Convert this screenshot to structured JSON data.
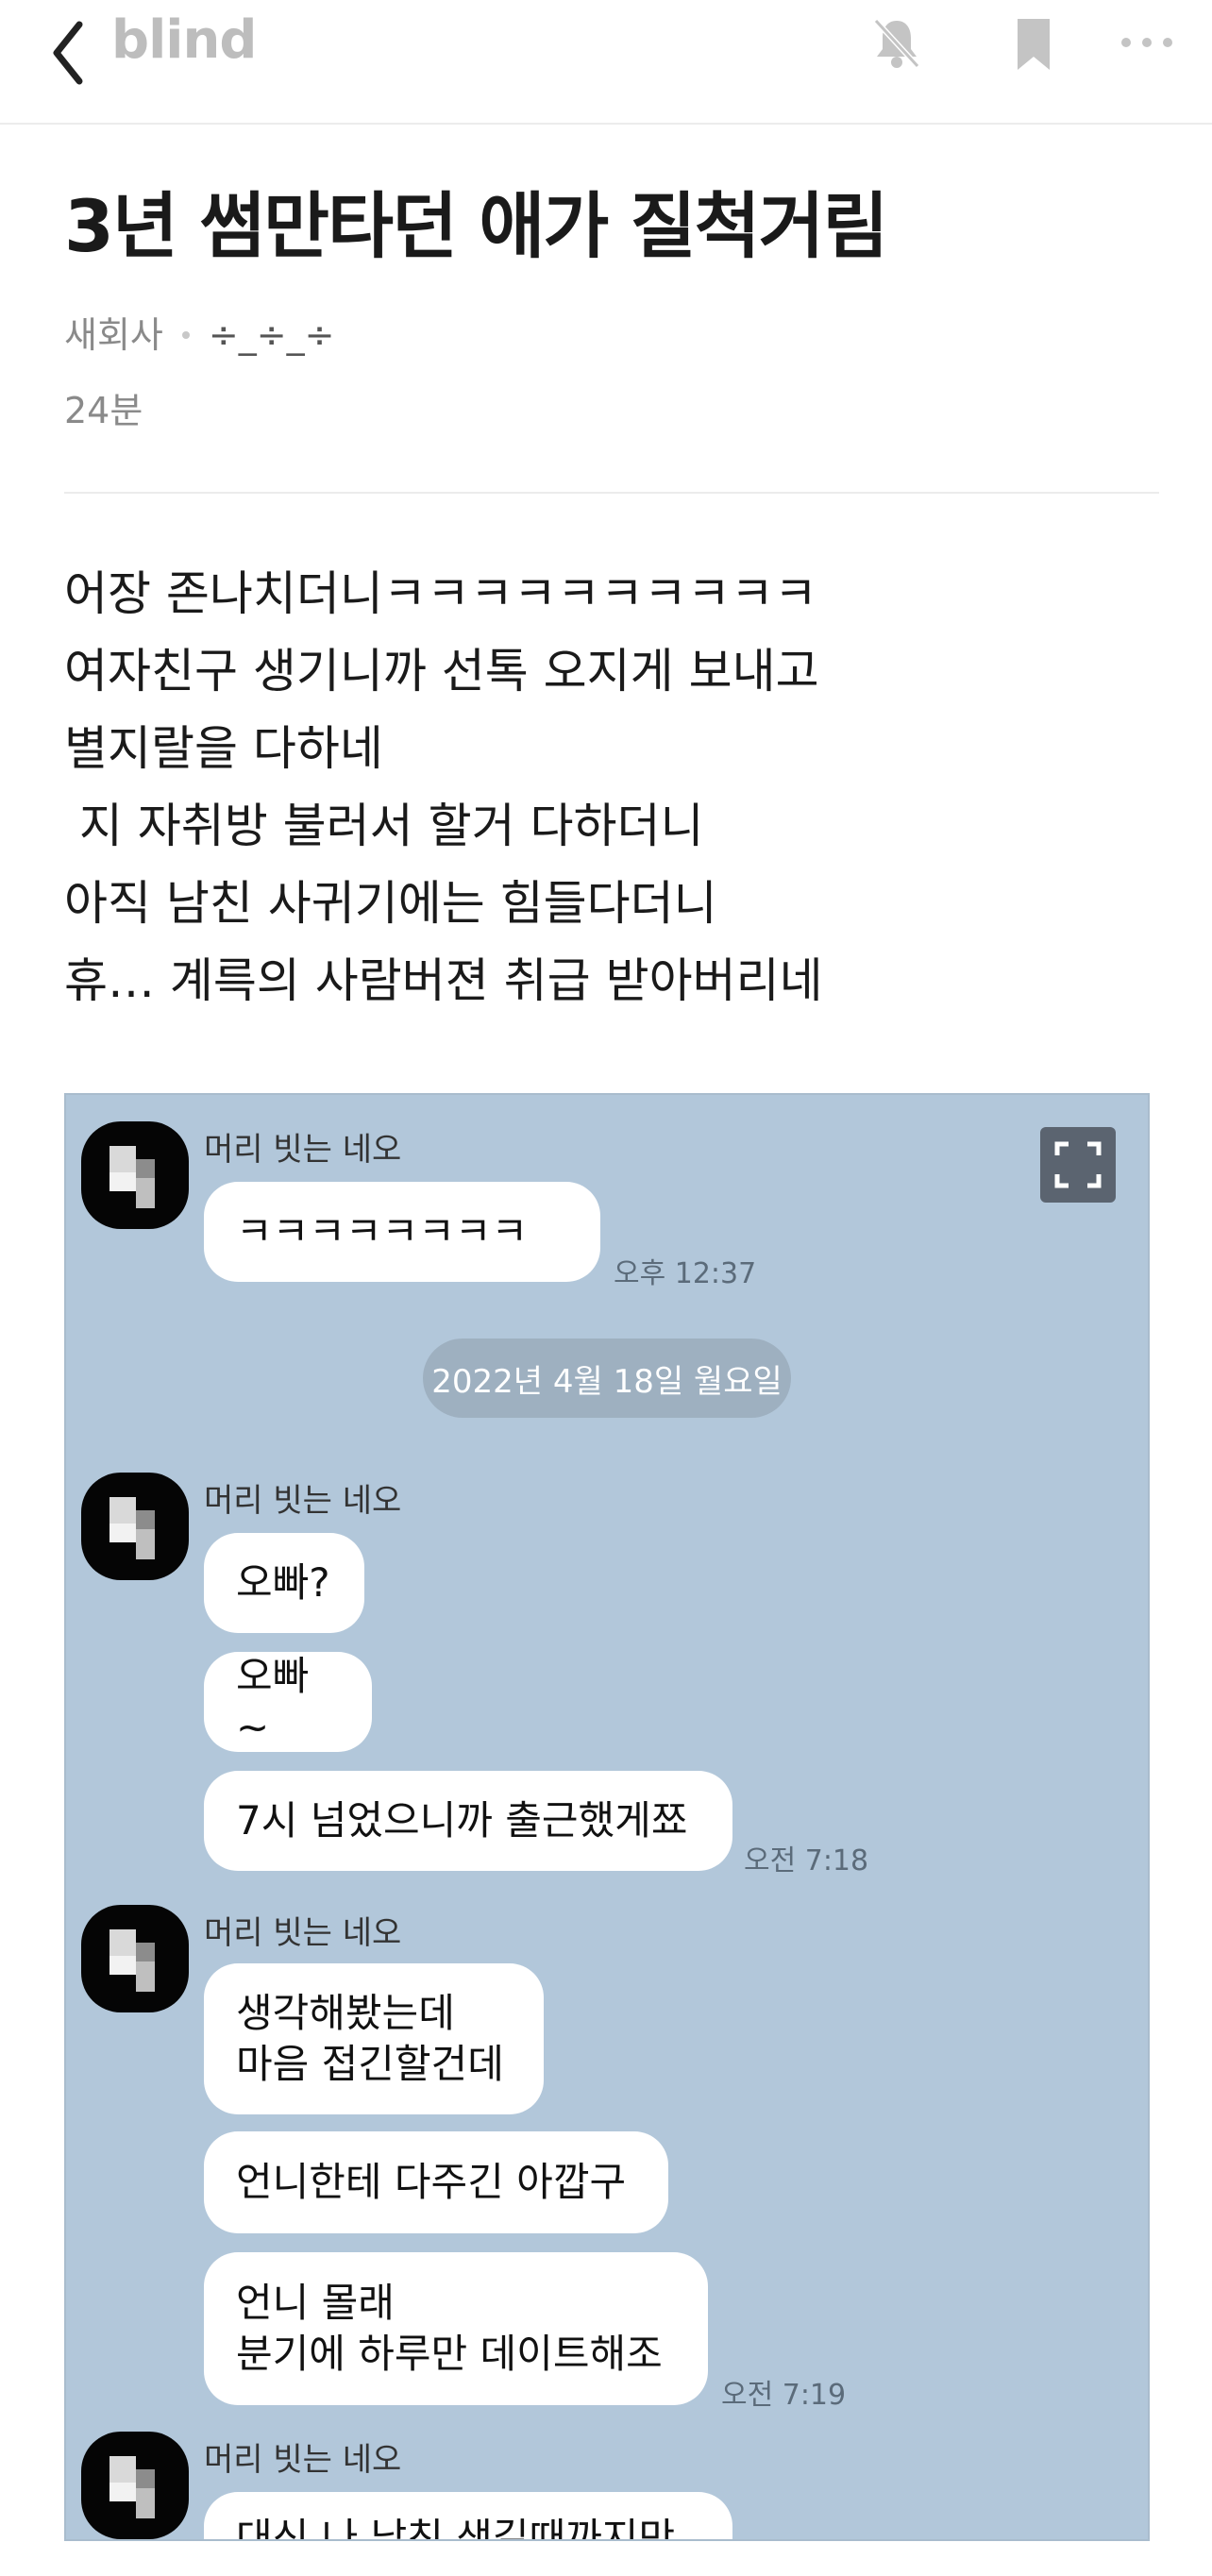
{
  "header": {
    "logo": "blind"
  },
  "post": {
    "title": "3년 썸만타던 애가 질척거림",
    "company": "새회사",
    "nickname": "÷_÷_÷",
    "time": "24분",
    "lines": [
      "어장 존나치더니ㅋㅋㅋㅋㅋㅋㅋㅋㅋㅋ",
      "여자친구 생기니까 선톡 오지게 보내고",
      "별지랄을 다하네",
      " 지 자취방 불러서 할거 다하더니",
      "아직 남친 사귀기에는 힘들다더니",
      "휴… 계륵의 사람버젼 취급 받아버리네"
    ]
  },
  "chat": {
    "sender": "머리 빗는 네오",
    "date_divider": "2022년 4월 18일 월요일",
    "groups": [
      {
        "messages": [
          "ㅋㅋㅋㅋㅋㅋㅋㅋ"
        ],
        "time": "오후 12:37"
      },
      {
        "messages": [
          "오빠?",
          "오빠~",
          "7시 넘었으니까 출근했게쬬"
        ],
        "time": "오전 7:18"
      },
      {
        "messages": [
          "생각해봤는데\n마음 접긴할건데",
          "언니한테 다주긴 아깝구",
          "언니 몰래\n분기에 하루만 데이트해조"
        ],
        "time": "오전 7:19"
      },
      {
        "messages": [
          "대신 나 남친 생길때까지만"
        ]
      }
    ]
  },
  "icons": {
    "back": "chevron-left-icon",
    "bell": "bell-off-icon",
    "bookmark": "bookmark-icon",
    "more": "more-horizontal-icon",
    "expand": "expand-icon"
  },
  "colors": {
    "chat_bg": "#b2c7da",
    "logo": "#bdbdbd"
  }
}
